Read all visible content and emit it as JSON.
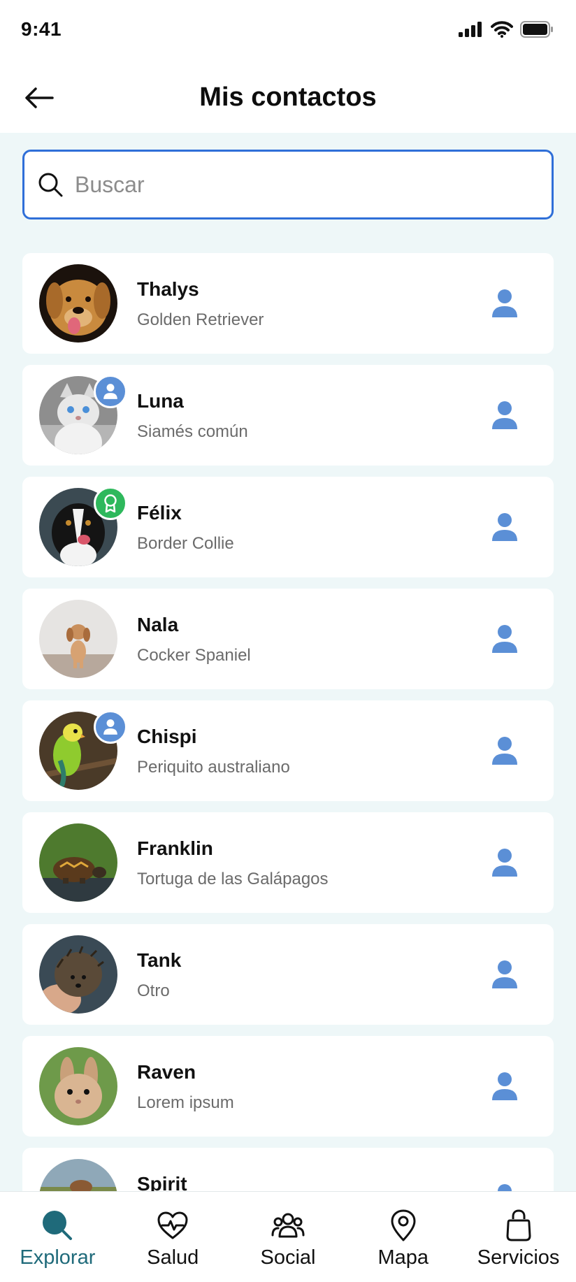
{
  "status_bar": {
    "time": "9:41"
  },
  "header": {
    "title": "Mis contactos"
  },
  "search": {
    "placeholder": "Buscar",
    "value": ""
  },
  "contacts": [
    {
      "name": "Thalys",
      "breed": "Golden Retriever",
      "badge": ""
    },
    {
      "name": "Luna",
      "breed": "Siamés común",
      "badge": "user"
    },
    {
      "name": "Félix",
      "breed": "Border Collie",
      "badge": "award"
    },
    {
      "name": "Nala",
      "breed": "Cocker Spaniel",
      "badge": ""
    },
    {
      "name": "Chispi",
      "breed": "Periquito australiano",
      "badge": "user"
    },
    {
      "name": "Franklin",
      "breed": "Tortuga de las Galápagos",
      "badge": ""
    },
    {
      "name": "Tank",
      "breed": "Otro",
      "badge": ""
    },
    {
      "name": "Raven",
      "breed": "Lorem ipsum",
      "badge": ""
    },
    {
      "name": "Spirit",
      "breed": "",
      "badge": ""
    }
  ],
  "tabbar": {
    "items": [
      {
        "label": "Explorar",
        "icon": "explore-icon",
        "active": true
      },
      {
        "label": "Salud",
        "icon": "health-heart-icon",
        "active": false
      },
      {
        "label": "Social",
        "icon": "people-icon",
        "active": false
      },
      {
        "label": "Mapa",
        "icon": "map-pin-icon",
        "active": false
      },
      {
        "label": "Servicios",
        "icon": "shopping-bag-icon",
        "active": false
      }
    ]
  },
  "colors": {
    "accent_blue": "#2F6FD8",
    "profile_icon": "#5B8FD6",
    "award_badge": "#2EB85C",
    "active_tab": "#1F6A7A",
    "background": "#EEF7F8"
  }
}
